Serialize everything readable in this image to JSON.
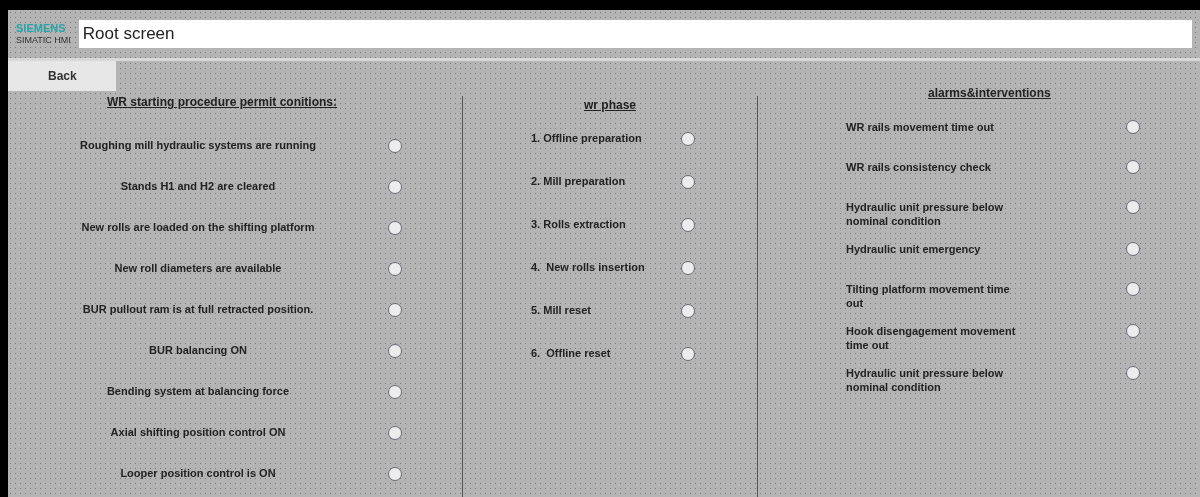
{
  "header": {
    "brand": "SIEMENS",
    "product": "SIMATIC HMI",
    "title": "Root screen"
  },
  "back_button": "Back",
  "permit_conditions": {
    "heading": "WR starting procedure permit conitions:",
    "items": [
      {
        "label": "Roughing mill hydraulic systems are running"
      },
      {
        "label": "Stands H1 and H2 are cleared"
      },
      {
        "label": "New rolls are loaded on the shifting platform"
      },
      {
        "label": "New roll diameters are available"
      },
      {
        "label": "BUR pullout ram is at full retracted position."
      },
      {
        "label": "BUR balancing ON"
      },
      {
        "label": "Bending system at balancing force"
      },
      {
        "label": "Axial shifting position control ON"
      },
      {
        "label": "Looper position control is ON"
      }
    ]
  },
  "wr_phase": {
    "heading": "wr phase",
    "items": [
      {
        "label": "1. Offline preparation"
      },
      {
        "label": "2. Mill preparation"
      },
      {
        "label": "3. Rolls extraction"
      },
      {
        "label": "4.  New rolls insertion"
      },
      {
        "label": "5. Mill reset"
      },
      {
        "label": "6.  Offline reset"
      }
    ]
  },
  "alarms": {
    "heading": "alarms&interventions",
    "items": [
      {
        "label": "WR rails movement time out"
      },
      {
        "label": "WR rails consistency check"
      },
      {
        "label": "Hydraulic unit pressure below nominal condition"
      },
      {
        "label": "Hydraulic unit emergency"
      },
      {
        "label": "Tilting platform movement time out"
      },
      {
        "label": "Hook disengagement movement time out"
      },
      {
        "label": "Hydraulic unit pressure below nominal condition"
      }
    ]
  }
}
